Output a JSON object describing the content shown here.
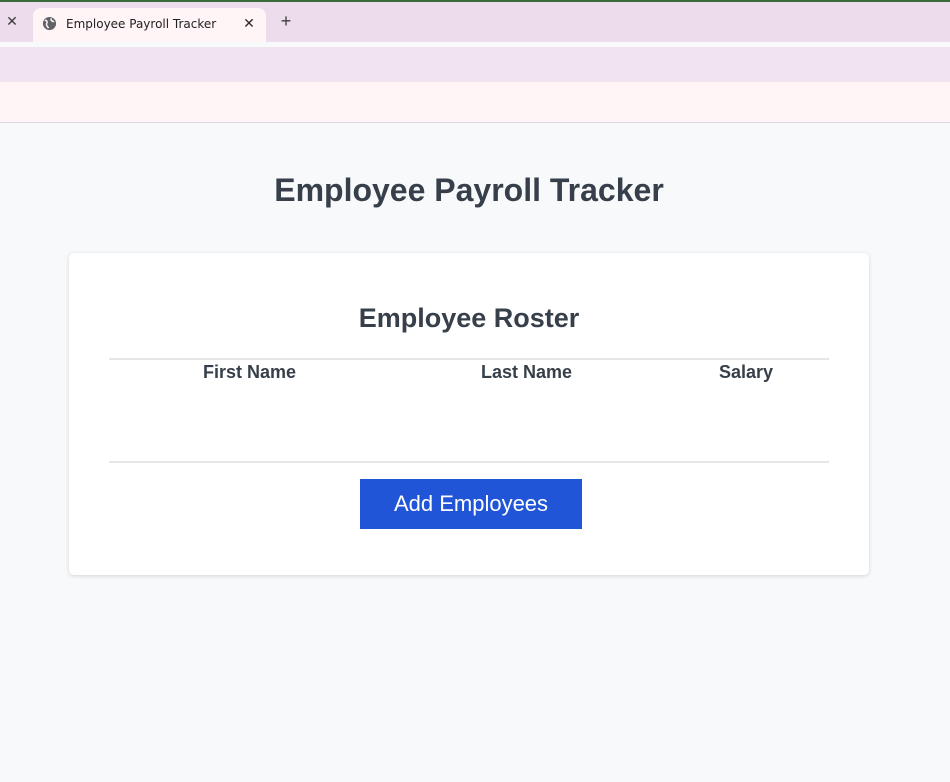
{
  "browser": {
    "tab_title": "Employee Payroll Tracker",
    "icons": {
      "favicon": "globe-icon",
      "tab_close": "close-icon",
      "new_tab": "plus-icon"
    }
  },
  "page": {
    "title": "Employee Payroll Tracker"
  },
  "roster": {
    "title": "Employee Roster",
    "columns": [
      "First Name",
      "Last Name",
      "Salary"
    ],
    "rows": [],
    "add_button_label": "Add Employees"
  },
  "colors": {
    "accent": "#1f55d6",
    "heading_text": "#37404a",
    "page_background": "#f8f9fb",
    "card_background": "#ffffff"
  }
}
